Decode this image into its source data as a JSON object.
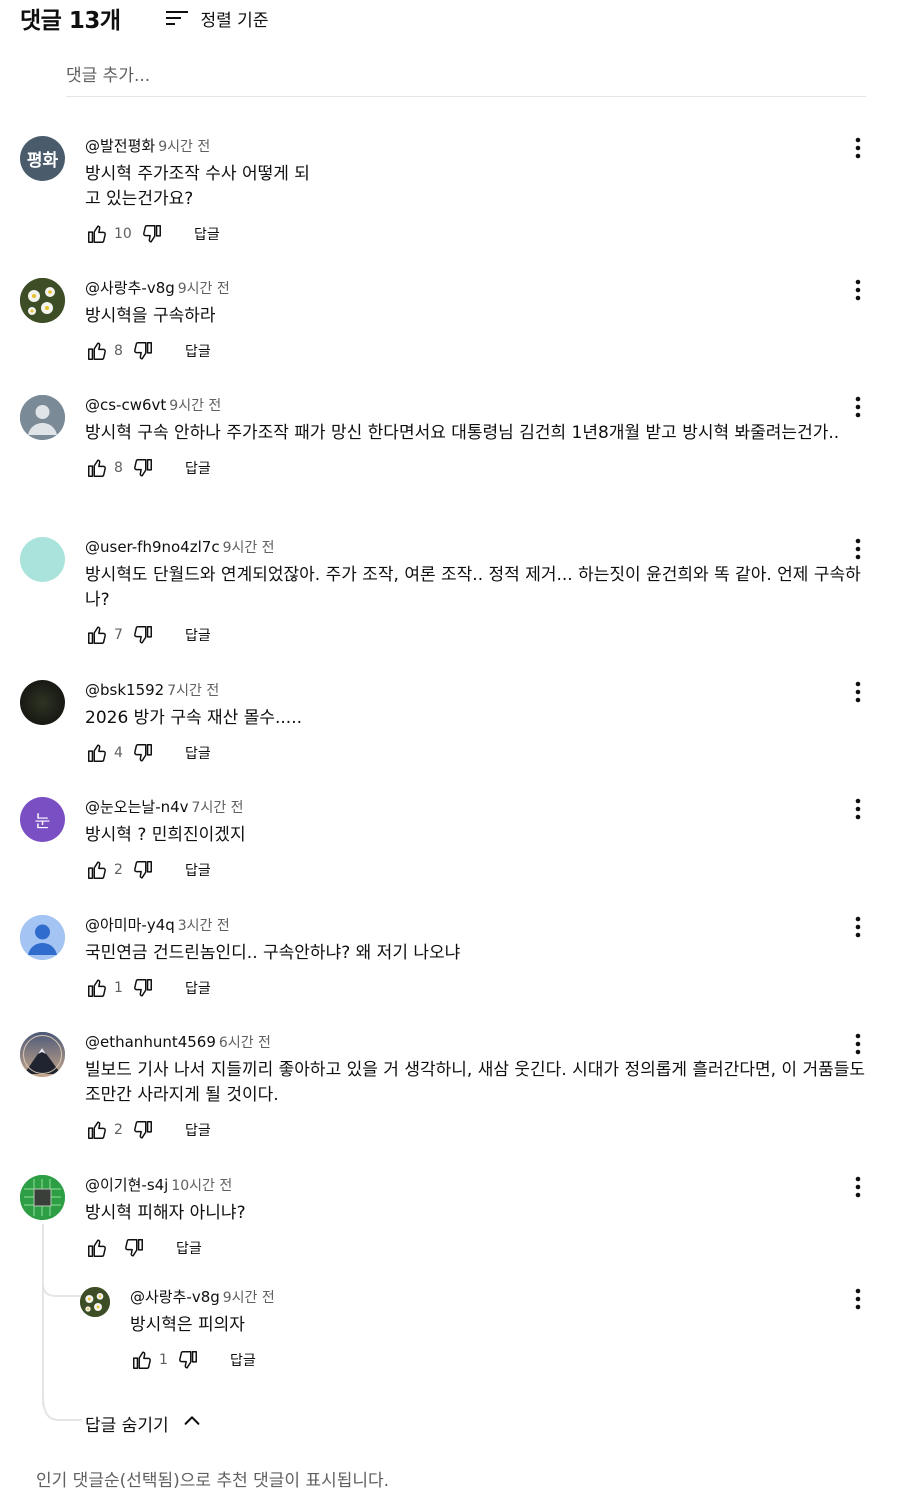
{
  "header": {
    "count_label": "댓글 13개",
    "sort_label": "정렬 기준"
  },
  "add_comment": {
    "placeholder": "댓글 추가..."
  },
  "comments": [
    {
      "author": "@발전평화",
      "time": "9시간 전",
      "text": "방시혁 주가조작 수사 어떻게 되\n고 있는건가요?",
      "likes": "10",
      "reply_label": "답글",
      "avatar_text": "평화",
      "avatar_color": "#4a5c6b"
    },
    {
      "author": "@사랑추-v8g",
      "time": "9시간 전",
      "text": "방시혁을 구속하라",
      "likes": "8",
      "reply_label": "답글",
      "avatar_color": "#4e5f33"
    },
    {
      "author": "@cs-cw6vt",
      "time": "9시간 전",
      "text": "방시혁 구속 안하나 주가조작 패가 망신 한다면서요 대통령님 김건희 1년8개월 받고 방시혁 봐줄려는건가..",
      "likes": "8",
      "reply_label": "답글",
      "avatar_color": "#7b8a97"
    },
    {
      "author": "@user-fh9no4zl7c",
      "time": "9시간 전",
      "text": "방시혁도 단월드와 연계되었잖아. 주가 조작, 여론 조작.. 정적 제거... 하는짓이 윤건희와 똑 같아. 언제 구속하나?",
      "likes": "7",
      "reply_label": "답글",
      "avatar_color": "#a9e3db"
    },
    {
      "author": "@bsk1592",
      "time": "7시간 전",
      "text": "2026 방가 구속 재산 몰수.....",
      "likes": "4",
      "reply_label": "답글",
      "avatar_color": "#1c1e18"
    },
    {
      "author": "@눈오는날-n4v",
      "time": "7시간 전",
      "text": "방시혁 ? 민희진이겠지",
      "likes": "2",
      "reply_label": "답글",
      "avatar_text": "눈",
      "avatar_color": "#7b4fc4"
    },
    {
      "author": "@아미마-y4q",
      "time": "3시간 전",
      "text": "국민연금 건드린놈인디.. 구속안하냐? 왜 저기 나오냐",
      "likes": "1",
      "reply_label": "답글",
      "avatar_color": "#a4c4f4"
    },
    {
      "author": "@ethanhunt4569",
      "time": "6시간 전",
      "text": "빌보드 기사 나서 지들끼리 좋아하고 있을 거 생각하니, 새삼 웃긴다. 시대가 정의롭게 흘러간다면, 이 거품들도 조만간 사라지게 될 것이다.",
      "likes": "2",
      "reply_label": "답글",
      "avatar_color": "#5a6d8a"
    },
    {
      "author": "@이기현-s4j",
      "time": "10시간 전",
      "text": "방시혁 피해자 아니냐?",
      "likes": "",
      "reply_label": "답글",
      "avatar_color": "#2e9e45"
    }
  ],
  "reply": {
    "author": "@사랑추-v8g",
    "time": "9시간 전",
    "text": "방시혁은 피의자",
    "likes": "1",
    "reply_label": "답글"
  },
  "hide_replies_label": "답글 숨기기",
  "footer_text": "인기 댓글순(선택됨)으로 추천 댓글이 표시됩니다."
}
